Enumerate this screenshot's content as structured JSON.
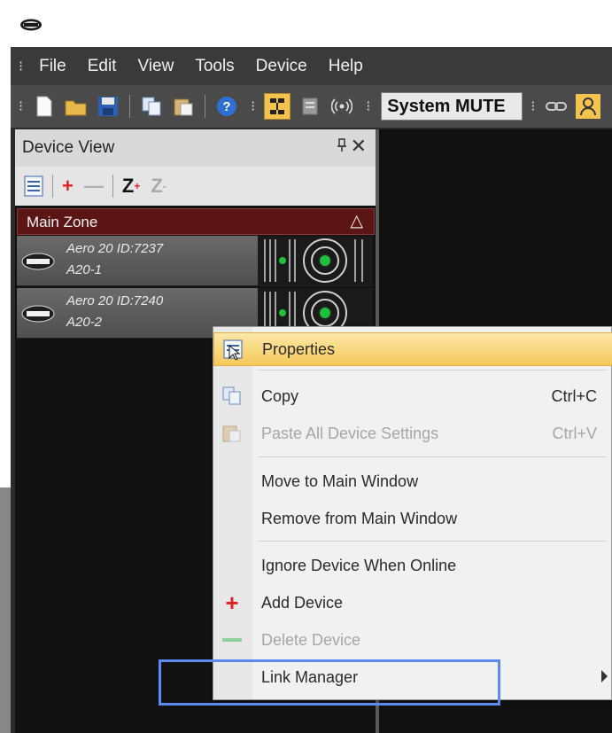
{
  "menubar": {
    "items": [
      "File",
      "Edit",
      "View",
      "Tools",
      "Device",
      "Help"
    ]
  },
  "toolbar": {
    "mute_label": "System MUTE"
  },
  "device_view": {
    "title": "Device View",
    "zone": "Main Zone",
    "devices": [
      {
        "name": "Aero 20  ID:7237",
        "sub": "A20-1"
      },
      {
        "name": "Aero 20  ID:7240",
        "sub": "A20-2"
      }
    ]
  },
  "context_menu": {
    "properties": "Properties",
    "copy": "Copy",
    "copy_shortcut": "Ctrl+C",
    "paste": "Paste All Device Settings",
    "paste_shortcut": "Ctrl+V",
    "move": "Move to Main Window",
    "remove": "Remove from Main Window",
    "ignore": "Ignore Device When Online",
    "add": "Add Device",
    "delete": "Delete Device",
    "link": "Link Manager"
  },
  "colors": {
    "highlight_box": "#5b8af0",
    "zone_bg": "#5b1515",
    "hover": "#f6c95a"
  }
}
